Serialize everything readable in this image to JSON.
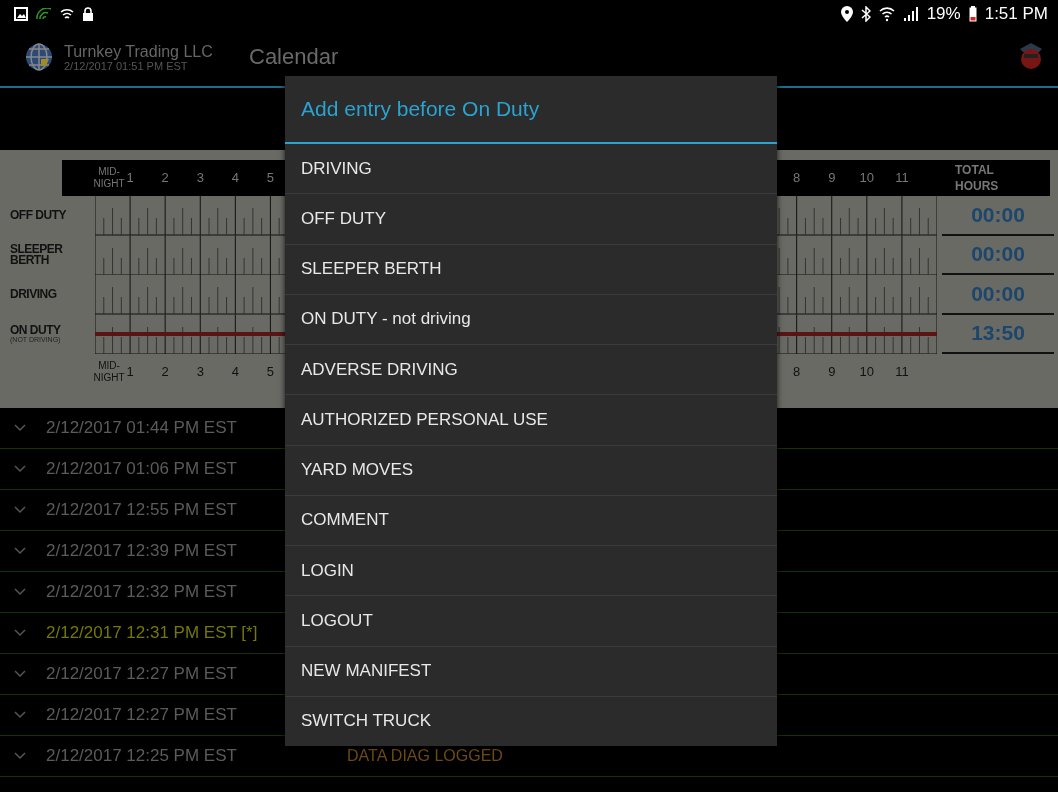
{
  "status_bar": {
    "battery": "19%",
    "time": "1:51 PM"
  },
  "app_bar": {
    "company": "Turnkey Trading LLC",
    "timestamp": "2/12/2017 01:51 PM EST",
    "title": "Calendar"
  },
  "log_graph": {
    "axis_labels_start": [
      "MID-NIGHT",
      "1",
      "2",
      "3",
      "4",
      "5"
    ],
    "axis_labels_end": [
      "8",
      "9",
      "10",
      "11"
    ],
    "bottom_labels_start": [
      "MID-NIGHT",
      "1",
      "2",
      "3",
      "4",
      "5"
    ],
    "bottom_labels_end": [
      "8",
      "9",
      "10",
      "11"
    ],
    "total_header": "TOTAL HOURS",
    "rows": [
      {
        "label": "OFF DUTY",
        "active": false,
        "total": "00:00"
      },
      {
        "label": "SLEEPER BERTH",
        "active": false,
        "total": "00:00"
      },
      {
        "label": "DRIVING",
        "active": false,
        "total": "00:00"
      },
      {
        "label": "ON DUTY",
        "sublabel": "(NOT DRIVING)",
        "active": true,
        "total": "13:50"
      }
    ]
  },
  "log_entries": [
    {
      "time": "2/12/2017 01:44 PM EST",
      "flagged": false
    },
    {
      "time": "2/12/2017 01:06 PM EST",
      "flagged": false
    },
    {
      "time": "2/12/2017 12:55 PM EST",
      "flagged": false
    },
    {
      "time": "2/12/2017 12:39 PM EST",
      "flagged": false
    },
    {
      "time": "2/12/2017 12:32 PM EST",
      "flagged": false
    },
    {
      "time": "2/12/2017 12:31 PM EST [*]",
      "flagged": true
    },
    {
      "time": "2/12/2017 12:27 PM EST",
      "flagged": false
    },
    {
      "time": "2/12/2017 12:27 PM EST",
      "flagged": false
    },
    {
      "time": "2/12/2017 12:25 PM EST",
      "flagged": false,
      "note": "DATA DIAG LOGGED"
    }
  ],
  "dialog": {
    "title": "Add entry before On Duty",
    "items": [
      "DRIVING",
      "OFF DUTY",
      "SLEEPER BERTH",
      "ON DUTY - not driving",
      "ADVERSE DRIVING",
      "AUTHORIZED PERSONAL USE",
      "YARD MOVES",
      "COMMENT",
      "LOGIN",
      "LOGOUT",
      "NEW MANIFEST",
      "SWITCH TRUCK"
    ]
  }
}
